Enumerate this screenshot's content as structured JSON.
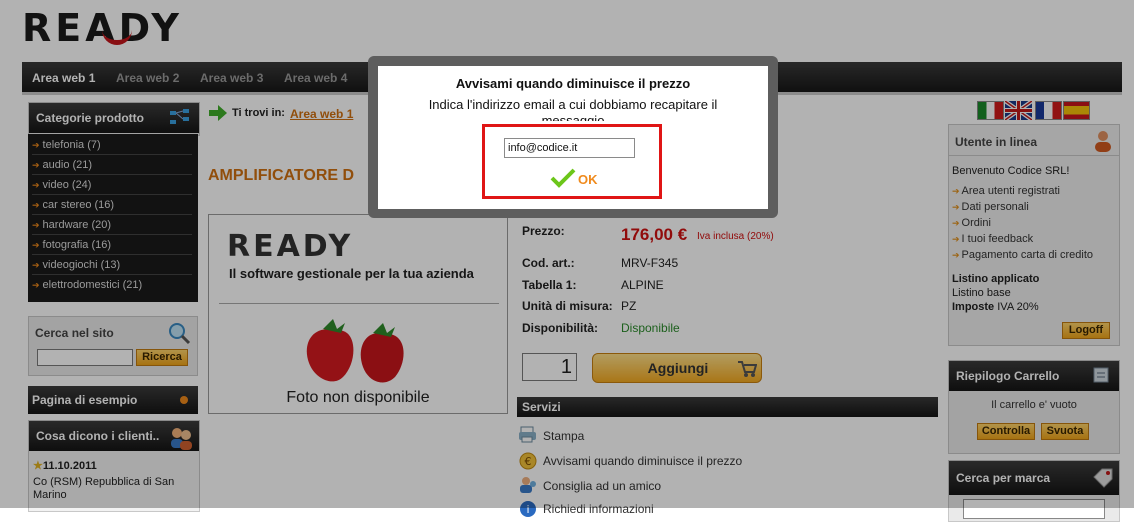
{
  "brand": {
    "logo": "READY"
  },
  "nav": {
    "tabs": [
      {
        "label": "Area web 1"
      },
      {
        "label": "Area web 2"
      },
      {
        "label": "Area web 3"
      },
      {
        "label": "Area web 4"
      }
    ]
  },
  "breadcrumb": {
    "prefix": "Ti trovi in:",
    "link": "Area web 1"
  },
  "categories": {
    "title": "Categorie prodotto",
    "items": [
      {
        "label": "telefonia (7)"
      },
      {
        "label": "audio (21)"
      },
      {
        "label": "video (24)"
      },
      {
        "label": "car stereo (16)"
      },
      {
        "label": "hardware (20)"
      },
      {
        "label": "fotografia (16)"
      },
      {
        "label": "videogiochi (13)"
      },
      {
        "label": "elettrodomestici (21)"
      }
    ]
  },
  "search": {
    "title": "Cerca nel sito",
    "button": "Ricerca",
    "value": ""
  },
  "example_page": {
    "title": "Pagina di esempio"
  },
  "testimonials": {
    "title": "Cosa dicono i clienti..",
    "date": "11.10.2011",
    "text": "Co (RSM) Repubblica di San Marino"
  },
  "product": {
    "title_visible": "AMPLIFICATORE D",
    "image_logo": "READY",
    "image_tagline": "Il software gestionale per la tua azienda",
    "image_caption": "Foto non disponibile",
    "price_label": "Prezzo:",
    "price": "176,00 €",
    "price_note": "Iva inclusa (20%)",
    "code_label": "Cod. art.:",
    "code": "MRV-F345",
    "table_label": "Tabella 1:",
    "table": "ALPINE",
    "unit_label": "Unità di misura:",
    "unit": "PZ",
    "avail_label": "Disponibilità:",
    "avail": "Disponibile",
    "quantity": "1",
    "add_button": "Aggiungi"
  },
  "services": {
    "title": "Servizi",
    "items": [
      {
        "label": "Stampa",
        "icon": "printer-icon"
      },
      {
        "label": "Avvisami quando diminuisce il prezzo",
        "icon": "price-alert-icon"
      },
      {
        "label": "Consiglia ad un amico",
        "icon": "share-friend-icon"
      },
      {
        "label": "Richiedi informazioni",
        "icon": "info-icon"
      }
    ]
  },
  "languages": [
    "it",
    "en",
    "fr",
    "es"
  ],
  "user": {
    "title": "Utente in linea",
    "welcome": "Benvenuto Codice SRL!",
    "links": [
      {
        "label": "Area utenti registrati"
      },
      {
        "label": "Dati personali"
      },
      {
        "label": "Ordini"
      },
      {
        "label": "I tuoi feedback"
      },
      {
        "label": "Pagamento carta di credito"
      }
    ],
    "pricelist_label": "Listino applicato",
    "pricelist": "Listino base",
    "tax_label": "Imposte",
    "tax": "IVA 20%",
    "logoff": "Logoff"
  },
  "cart": {
    "title": "Riepilogo Carrello",
    "empty": "Il carrello e' vuoto",
    "control": "Controlla",
    "empty_btn": "Svuota"
  },
  "brand_search": {
    "title": "Cerca per marca"
  },
  "modal": {
    "title": "Avvisami quando diminuisce il prezzo",
    "message": "Indica l'indirizzo email a cui dobbiamo recapitare il messaggio",
    "email": "info@codice.it",
    "ok": "OK"
  },
  "colors": {
    "accent": "#f08a1c",
    "price": "#d01010",
    "highlight": "#e01515",
    "available": "#2a8a2a"
  }
}
